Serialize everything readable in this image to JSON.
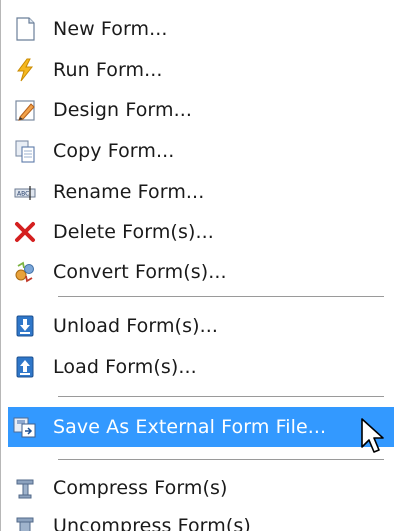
{
  "menu": {
    "items": [
      {
        "label": "New Form...",
        "icon": "new-document-icon"
      },
      {
        "label": "Run Form...",
        "icon": "lightning-icon"
      },
      {
        "label": "Design Form...",
        "icon": "pencil-design-icon"
      },
      {
        "label": "Copy Form...",
        "icon": "copy-icon"
      },
      {
        "label": "Rename Form...",
        "icon": "rename-icon"
      },
      {
        "label": "Delete Form(s)...",
        "icon": "delete-x-icon"
      },
      {
        "label": "Convert Form(s)...",
        "icon": "convert-icon"
      },
      {
        "label": "Unload Form(s)...",
        "icon": "unload-down-arrow-icon"
      },
      {
        "label": "Load Form(s)...",
        "icon": "load-up-arrow-icon"
      },
      {
        "label": "Save As External Form File...",
        "icon": "save-external-icon",
        "highlighted": true
      },
      {
        "label": "Compress Form(s)",
        "icon": "compress-icon"
      },
      {
        "label": "Uncompress Form(s)",
        "icon": "uncompress-icon"
      }
    ]
  },
  "colors": {
    "highlight": "#3399ff",
    "text": "#1a1a1a",
    "separator": "#9a9a9a"
  }
}
